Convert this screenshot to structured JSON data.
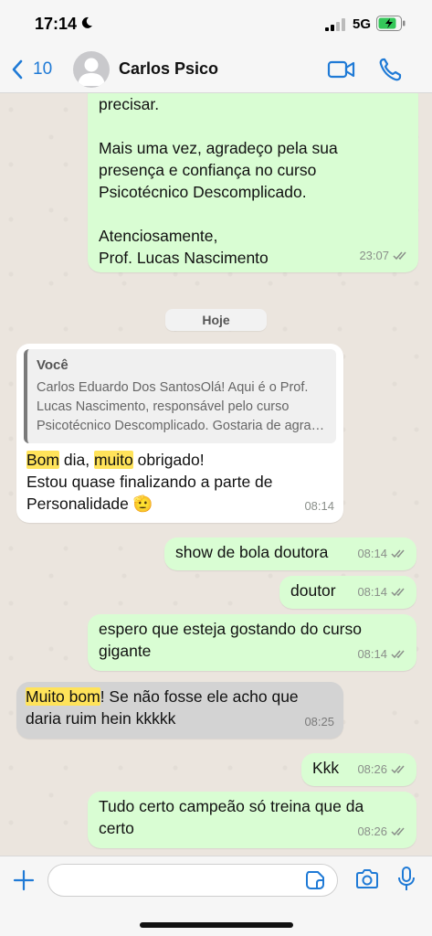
{
  "status_bar": {
    "time": "17:14",
    "network": "5G"
  },
  "header": {
    "back_count": "10",
    "contact_name": "Carlos Psico"
  },
  "messages": [
    {
      "direction": "outgoing",
      "text": "precisar.\n\nMais uma vez, agradeço pela sua\npresença e confiança no curso\nPsicotécnico Descomplicado.\n\nAtenciosamente,\nProf. Lucas Nascimento",
      "time": "23:07",
      "status": "read"
    },
    {
      "direction": "incoming",
      "quote": {
        "author": "Você",
        "text": "Carlos Eduardo Dos SantosOlá! Aqui é o Prof.\nLucas Nascimento, responsável pelo curso\nPsicotécnico Descomplicado. Gostaria de agra…"
      },
      "parts": [
        "Bom",
        " dia, ",
        "muito",
        " obrigado!\nEstou quase finalizando a parte de\nPersonalidade 🫡"
      ],
      "time": "08:14"
    },
    {
      "direction": "outgoing",
      "text": "show de bola doutora",
      "time": "08:14",
      "status": "read"
    },
    {
      "direction": "outgoing",
      "text": "doutor",
      "time": "08:14",
      "status": "read"
    },
    {
      "direction": "outgoing",
      "text": "espero que esteja gostando do curso\ngigante",
      "time": "08:14",
      "status": "read"
    },
    {
      "direction": "incoming",
      "parts": [
        "Muito bom",
        "! Se não fosse ele acho que\ndaria ruim hein kkkkk"
      ],
      "time": "08:25"
    },
    {
      "direction": "outgoing",
      "text": "Kkk",
      "time": "08:26",
      "status": "read"
    },
    {
      "direction": "outgoing",
      "text": "Tudo certo campeão só treina que da\ncerto",
      "time": "08:26",
      "status": "read"
    }
  ],
  "date_divider": "Hoje",
  "input": {
    "placeholder": "",
    "value": ""
  },
  "colors": {
    "accent": "#1f7ad6",
    "outgoing_bubble": "#d9fdd3",
    "incoming_bubble": "#ffffff",
    "highlight": "#ffe35a"
  },
  "icons": [
    "moon-icon",
    "signal-icon",
    "battery-charging-icon",
    "back-chevron-icon",
    "avatar-placeholder-icon",
    "video-camera-icon",
    "phone-icon",
    "read-ticks-icon",
    "plus-icon",
    "sticker-icon",
    "camera-icon",
    "microphone-icon"
  ]
}
